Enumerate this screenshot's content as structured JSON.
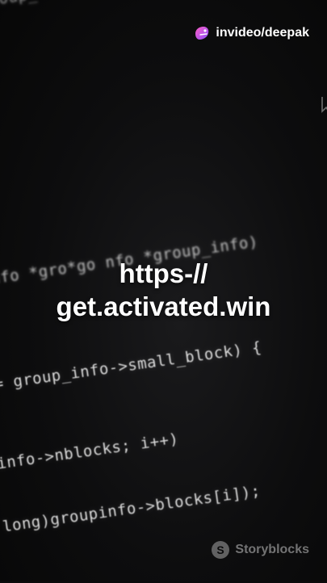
{
  "watermark": {
    "text": "invideo/deepak",
    "icon": "invideo-logo-icon"
  },
  "headline": {
    "line1": "https-//",
    "line2": "get.activated.win"
  },
  "code_lines": [
    "oup_",
    "nfo *gro*go  nfo *group_info)",
    "= group_info->small_block) {",
    "_info->nblocks; i++)",
    "ed long)groupinfo->blocks[i]);"
  ],
  "storyblocks": {
    "text": "Storyblocks",
    "icon": "storyblocks-logo-icon"
  }
}
